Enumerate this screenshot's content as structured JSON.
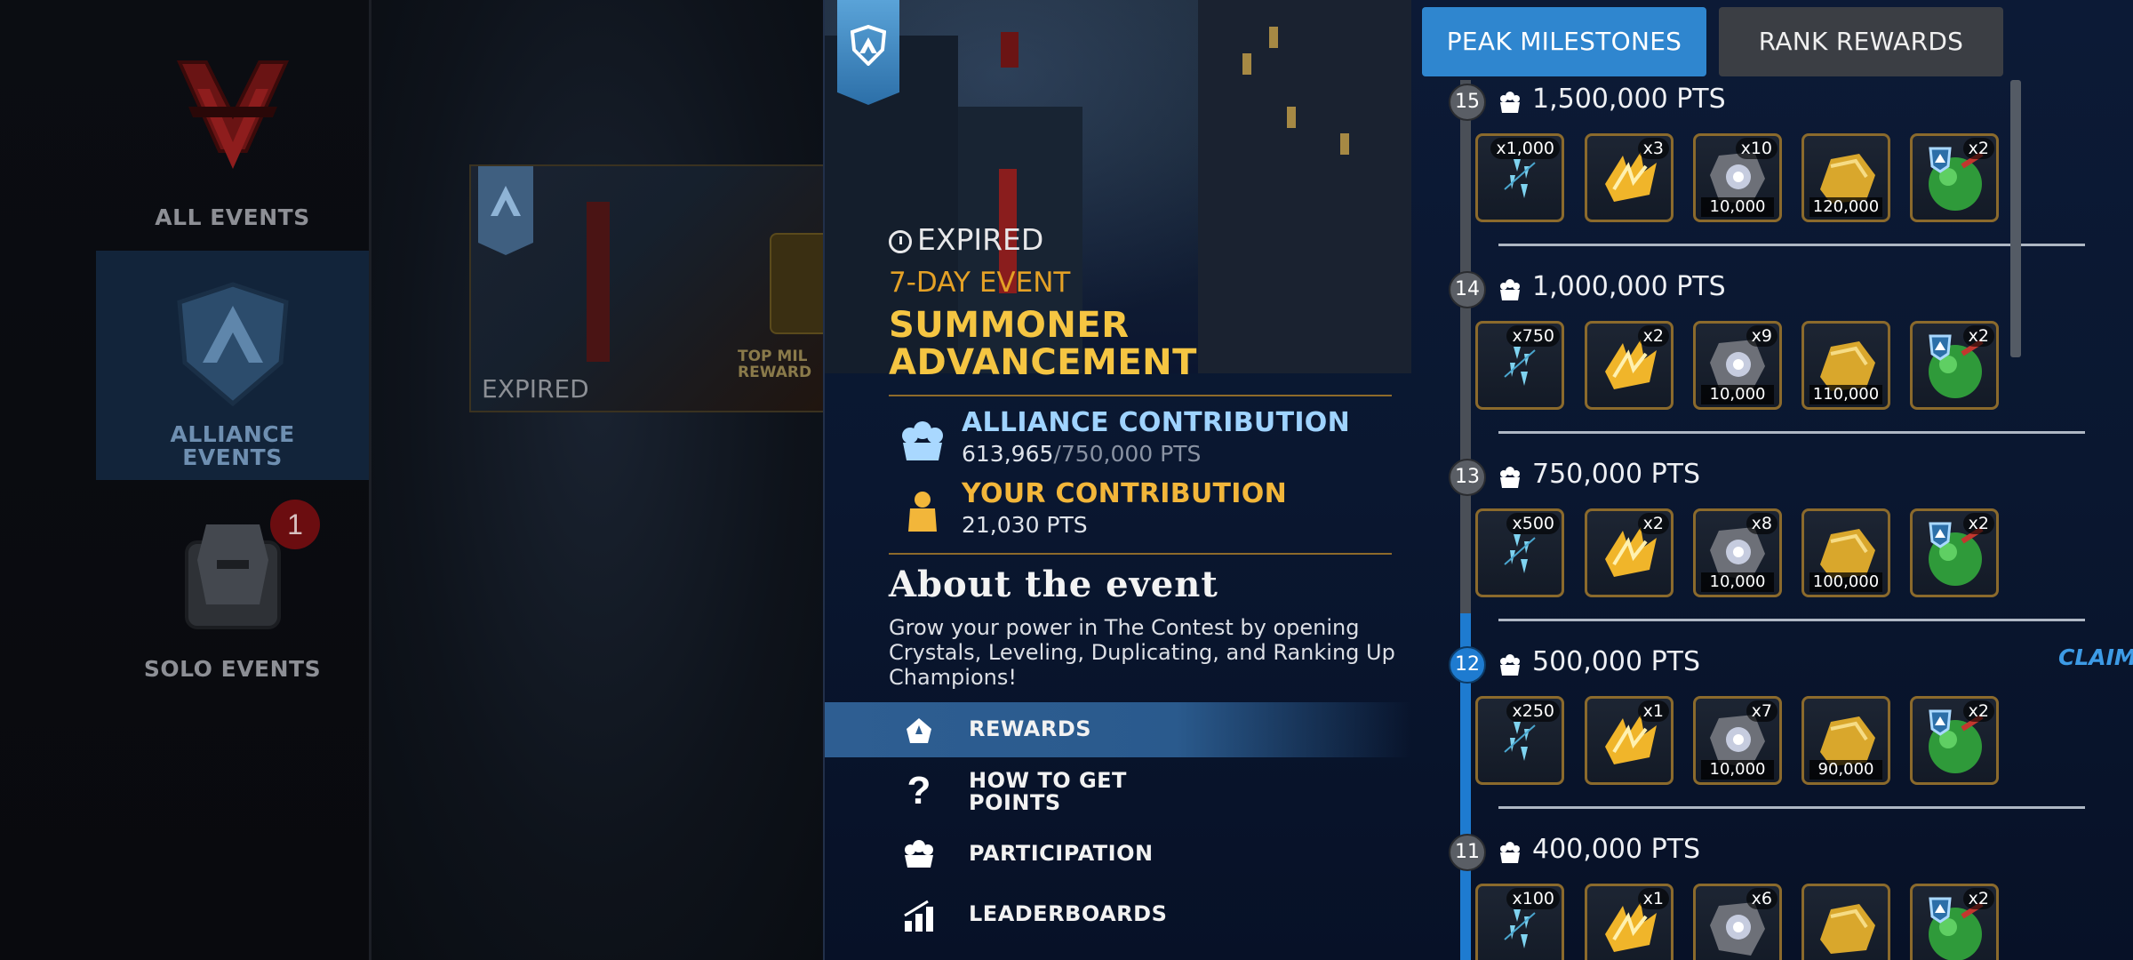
{
  "nav": {
    "all_events": "ALL EVENTS",
    "alliance_events": "ALLIANCE EVENTS",
    "solo_events": "SOLO EVENTS",
    "solo_badge": "1"
  },
  "background_card": {
    "status": "EXPIRED",
    "milestone_label": "TOP MIL REWARD"
  },
  "event": {
    "status": "EXPIRED",
    "duration": "7-DAY EVENT",
    "title": "SUMMONER ADVANCEMENT",
    "alliance_contribution_label": "ALLIANCE CONTRIBUTION",
    "alliance_contribution_current": "613,965",
    "alliance_contribution_goal": "/750,000 PTS",
    "your_contribution_label": "YOUR CONTRIBUTION",
    "your_contribution_value": "21,030 PTS",
    "about_title": "About the event",
    "about_desc": "Grow your power in The Contest by opening Crystals, Leveling, Duplicating, and Ranking Up Champions!"
  },
  "menu": {
    "rewards": "REWARDS",
    "how_to_get_points": "HOW TO GET POINTS",
    "participation": "PARTICIPATION",
    "leaderboards": "LEADERBOARDS"
  },
  "tabs": {
    "peak_milestones": "PEAK MILESTONES",
    "rank_rewards": "RANK REWARDS"
  },
  "milestones": [
    {
      "num": "15",
      "pts": "1,500,000 PTS",
      "claimed": "",
      "rewards": [
        {
          "icon": "shard-icon",
          "qty": "x1,000",
          "amt": ""
        },
        {
          "icon": "gold-shards-icon",
          "qty": "x3",
          "amt": ""
        },
        {
          "icon": "iso-8-icon",
          "qty": "x10",
          "amt": "10,000"
        },
        {
          "icon": "gold-icon",
          "qty": "",
          "amt": "120,000"
        },
        {
          "icon": "alliance-potion-icon",
          "qty": "x2",
          "amt": ""
        }
      ]
    },
    {
      "num": "14",
      "pts": "1,000,000 PTS",
      "claimed": "",
      "rewards": [
        {
          "icon": "shard-icon",
          "qty": "x750",
          "amt": ""
        },
        {
          "icon": "gold-shards-icon",
          "qty": "x2",
          "amt": ""
        },
        {
          "icon": "iso-8-icon",
          "qty": "x9",
          "amt": "10,000"
        },
        {
          "icon": "gold-icon",
          "qty": "",
          "amt": "110,000"
        },
        {
          "icon": "alliance-potion-icon",
          "qty": "x2",
          "amt": ""
        }
      ]
    },
    {
      "num": "13",
      "pts": "750,000 PTS",
      "claimed": "",
      "rewards": [
        {
          "icon": "shard-icon",
          "qty": "x500",
          "amt": ""
        },
        {
          "icon": "gold-shards-icon",
          "qty": "x2",
          "amt": ""
        },
        {
          "icon": "iso-8-icon",
          "qty": "x8",
          "amt": "10,000"
        },
        {
          "icon": "gold-icon",
          "qty": "",
          "amt": "100,000"
        },
        {
          "icon": "alliance-potion-icon",
          "qty": "x2",
          "amt": ""
        }
      ]
    },
    {
      "num": "12",
      "pts": "500,000 PTS",
      "claimed": "CLAIMED!",
      "rewards": [
        {
          "icon": "shard-icon",
          "qty": "x250",
          "amt": ""
        },
        {
          "icon": "gold-shards-icon",
          "qty": "x1",
          "amt": ""
        },
        {
          "icon": "iso-8-icon",
          "qty": "x7",
          "amt": "10,000"
        },
        {
          "icon": "gold-icon",
          "qty": "",
          "amt": "90,000"
        },
        {
          "icon": "alliance-potion-icon",
          "qty": "x2",
          "amt": ""
        }
      ]
    },
    {
      "num": "11",
      "pts": "400,000 PTS",
      "claimed": "",
      "rewards": [
        {
          "icon": "shard-icon",
          "qty": "x100",
          "amt": ""
        },
        {
          "icon": "gold-shards-icon",
          "qty": "x1",
          "amt": ""
        },
        {
          "icon": "iso-8-icon",
          "qty": "x6",
          "amt": ""
        },
        {
          "icon": "gold-icon",
          "qty": "",
          "amt": ""
        },
        {
          "icon": "alliance-potion-icon",
          "qty": "x2",
          "amt": ""
        }
      ]
    }
  ],
  "colors": {
    "accent_blue": "#2f86cf",
    "gold_text": "#f5c542",
    "alliance_blue": "#9fd3ff",
    "claimed": "#3d9be6"
  }
}
